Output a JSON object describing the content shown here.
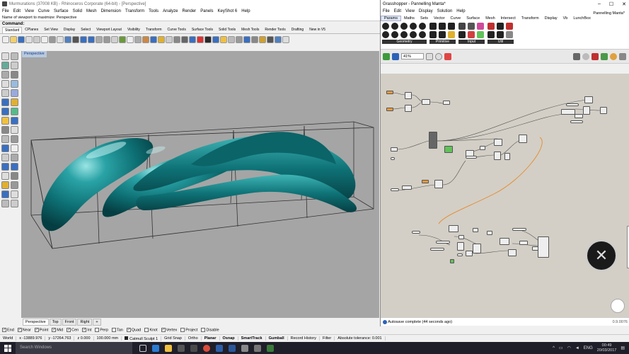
{
  "rhino": {
    "title": "Murmurations (37008 KB) - Rhinoceros Corporate (64-bit) - [Perspective]",
    "menu": [
      "File",
      "Edit",
      "View",
      "Curve",
      "Surface",
      "Solid",
      "Mesh",
      "Dimension",
      "Transform",
      "Tools",
      "Analyze",
      "Render",
      "Panels",
      "KeyShot 6",
      "Help"
    ],
    "command_history": "Name of viewport to maximize: Perspective",
    "command_label": "Command:",
    "toolbar_tabs": [
      "Standard",
      "CPlanes",
      "Set View",
      "Display",
      "Select",
      "Viewport Layout",
      "Visibility",
      "Transform",
      "Curve Tools",
      "Surface Tools",
      "Solid Tools",
      "Mesh Tools",
      "Render Tools",
      "Drafting",
      "New in V5"
    ],
    "viewport_label": "Perspective",
    "view_tabs": [
      "Perspective",
      "Top",
      "Front",
      "Right"
    ],
    "view_tab_add": "+",
    "osnaps": [
      {
        "label": "End",
        "checked": true
      },
      {
        "label": "Near",
        "checked": true
      },
      {
        "label": "Point",
        "checked": true
      },
      {
        "label": "Mid",
        "checked": true
      },
      {
        "label": "Cen",
        "checked": true
      },
      {
        "label": "Int",
        "checked": true
      },
      {
        "label": "Perp",
        "checked": false
      },
      {
        "label": "Tan",
        "checked": false
      },
      {
        "label": "Quad",
        "checked": true
      },
      {
        "label": "Knot",
        "checked": false
      },
      {
        "label": "Vertex",
        "checked": true
      },
      {
        "label": "Project",
        "checked": false
      },
      {
        "label": "Disable",
        "checked": false
      }
    ],
    "status": {
      "cplane": "World",
      "x": "x -13889.976",
      "y": "y -17264.763",
      "z": "z 0.000",
      "units": "100.000 mm",
      "layer": "Catmull Sculpt 1",
      "grid_snap": "Grid Snap",
      "ortho": "Ortho",
      "planar": "Planar",
      "osnap": "Osnap",
      "smarttrack": "SmartTrack",
      "gumball": "Gumball",
      "record": "Record History",
      "filter": "Filter",
      "tolerance": "Absolute tolerance: 0.001"
    }
  },
  "grasshopper": {
    "title": "Grasshopper - Pannelling Manta*",
    "doc_name": "Pannelling Manta*",
    "menu": [
      "File",
      "Edit",
      "View",
      "Display",
      "Solution",
      "Help"
    ],
    "tabs": [
      "Params",
      "Maths",
      "Sets",
      "Vector",
      "Curve",
      "Surface",
      "Mesh",
      "Intersect",
      "Transform",
      "Display",
      "Vb",
      "LunchBox"
    ],
    "ribbon_groups": [
      "Geometry",
      "Primitive",
      "Input",
      "Util"
    ],
    "zoom": "41%",
    "status_text": "Autosave complete (44 seconds ago)",
    "version": "0.9.0076"
  },
  "taskbar": {
    "search_placeholder": "Search Windows",
    "lang": "ENG",
    "time": "00:49",
    "date": "20/03/2017"
  },
  "colors": {
    "viewport_bg": "#a5a5a5",
    "sculpt": "#0f7a7e",
    "gh_canvas": "#d3cfc6",
    "wire_orange": "#e8882a"
  }
}
